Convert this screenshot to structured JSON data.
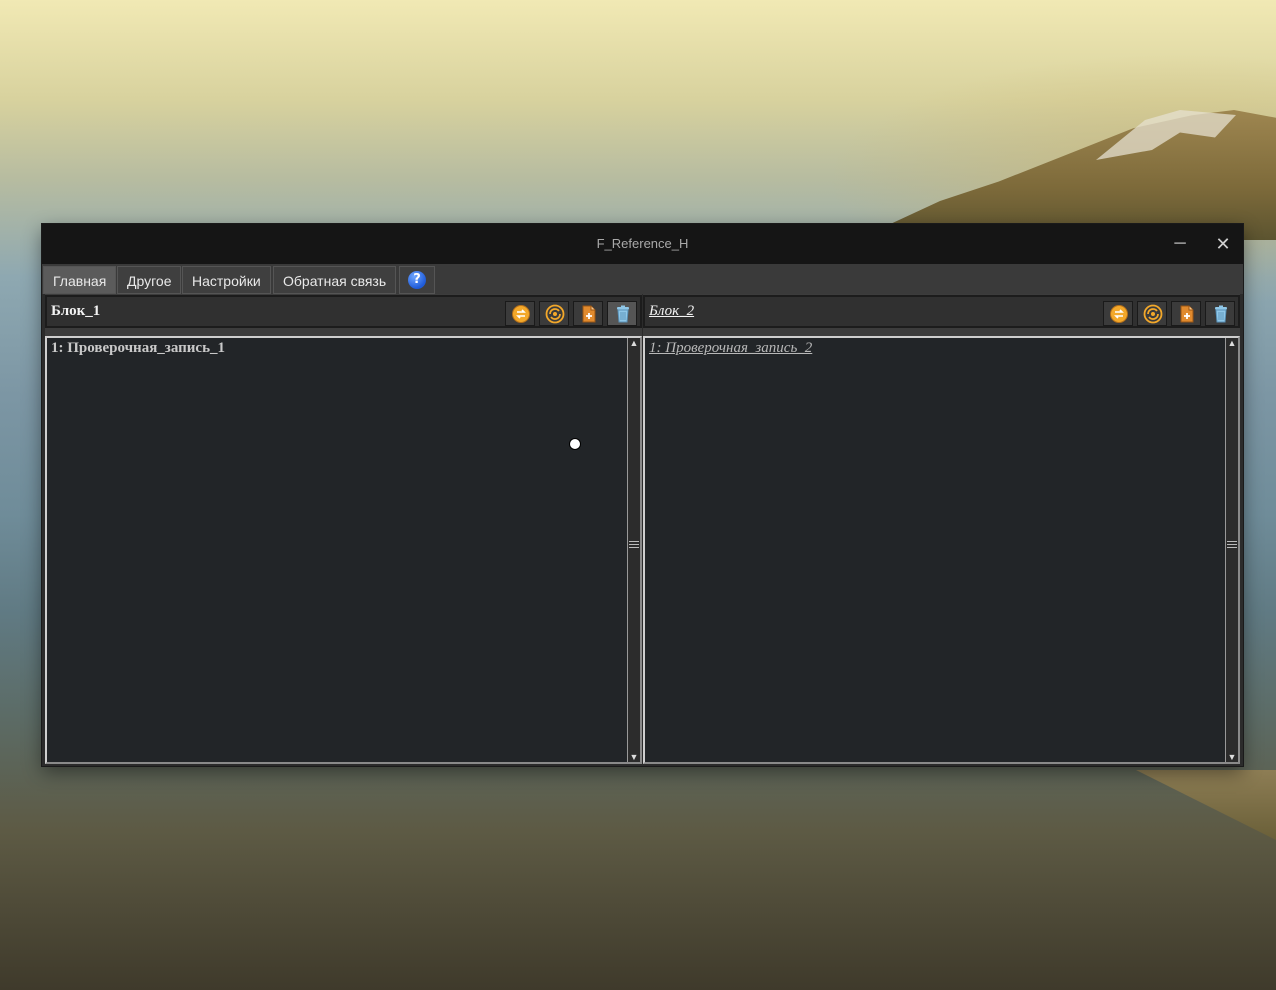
{
  "window": {
    "title": "F_Reference_H"
  },
  "tabs": [
    {
      "label": "Главная"
    },
    {
      "label": "Другое"
    },
    {
      "label": "Настройки"
    },
    {
      "label": "Обратная связь"
    },
    {
      "label": "?"
    }
  ],
  "panels": {
    "left": {
      "title": "Блок_1",
      "items": [
        "1: Проверочная_запись_1"
      ]
    },
    "right": {
      "title": "Блок_2",
      "items": [
        "1: Проверочная_запись_2"
      ]
    }
  },
  "colors": {
    "accent_orange": "#f3a82a",
    "trash_blue": "#8fc7e8",
    "help_blue": "#1f5bd8"
  },
  "icons": [
    "swap-icon",
    "refresh-icon",
    "add-document-icon",
    "trash-icon",
    "help-icon"
  ]
}
